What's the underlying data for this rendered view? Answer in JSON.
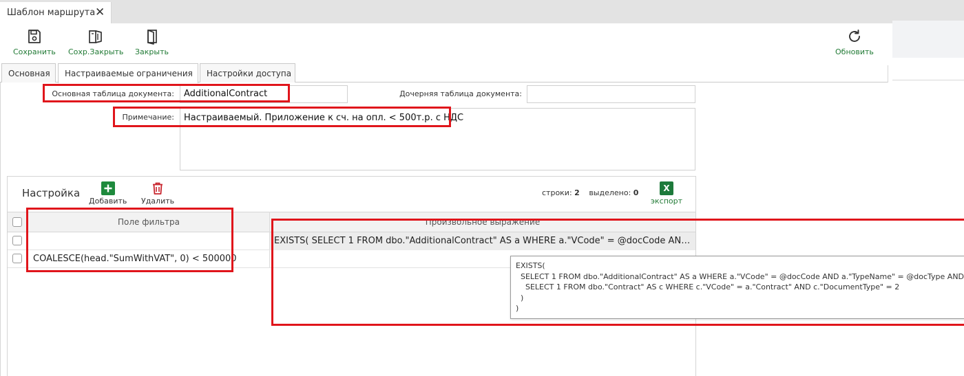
{
  "doc_tab": {
    "title": "Шаблон маршрута"
  },
  "toolbar": {
    "save_label": "Сохранить",
    "save_close_label": "Сохр.Закрыть",
    "close_label": "Закрыть",
    "refresh_label": "Обновить"
  },
  "section_tabs": [
    "Основная",
    "Настраиваемые ограничения",
    "Настройки доступа"
  ],
  "form": {
    "main_table_label": "Основная таблица документа:",
    "main_table_value": "AdditionalContract",
    "child_table_label": "Дочерняя таблица документа:",
    "child_table_value": "",
    "note_label": "Примечание:",
    "note_value": "Настраиваемый. Приложение к сч. на опл. < 500т.р. с НДС"
  },
  "grid": {
    "title": "Настройка",
    "add_label": "Добавить",
    "delete_label": "Удалить",
    "rows_label": "строки:",
    "rows_count": "2",
    "selected_label": "выделено:",
    "selected_count": "0",
    "export_label": "экспорт",
    "excel_glyph": "X",
    "columns": [
      "Поле фильтра",
      "Произвольное выражение"
    ],
    "rows": [
      {
        "filter": "",
        "expression": "EXISTS( SELECT 1 FROM dbo.\"AdditionalContract\" AS a WHERE a.\"VCode\" = @docCode AND a.\"T..."
      },
      {
        "filter": "COALESCE(head.\"SumWithVAT\", 0) < 500000",
        "expression": ""
      }
    ]
  },
  "tooltip": {
    "text": "EXISTS(\n  SELECT 1 FROM dbo.\"AdditionalContract\" AS a WHERE a.\"VCode\" = @docCode AND a.\"TypeName\" = @docType AND\n    SELECT 1 FROM dbo.\"Contract\" AS c WHERE c.\"VCode\" = a.\"Contract\" AND c.\"DocumentType\" = 2\n  )\n)"
  },
  "colors": {
    "accent_green": "#217a35",
    "delete_red": "#c8232c",
    "highlight_red": "#e0151b",
    "excel_green": "#1d7a3b"
  },
  "icons": [
    "save-icon",
    "save-close-icon",
    "close-door-icon",
    "refresh-icon",
    "add-icon",
    "trash-icon",
    "excel-icon",
    "close-icon"
  ]
}
